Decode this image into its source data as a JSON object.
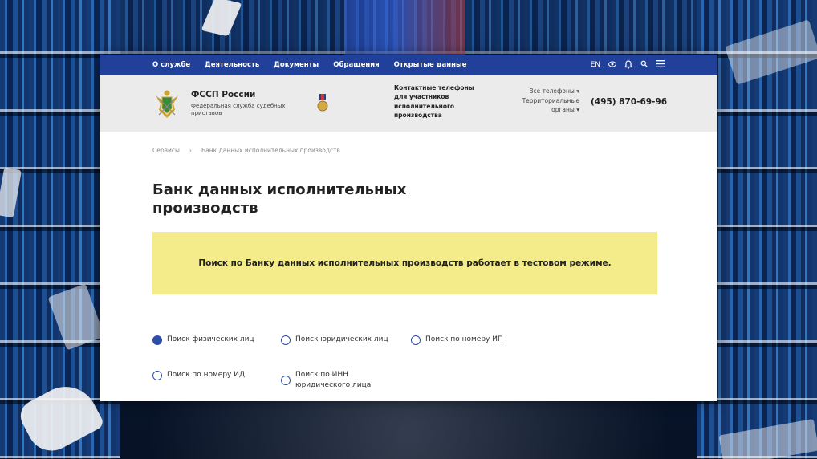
{
  "topnav": {
    "items": [
      "О службе",
      "Деятельность",
      "Документы",
      "Обращения",
      "Открытые данные"
    ],
    "lang": "EN"
  },
  "icons": {
    "vision": "eye-icon",
    "notifications": "bell-icon",
    "search": "search-icon",
    "menu": "menu-icon",
    "emblem": "fssp-emblem-icon",
    "medal": "medal-icon"
  },
  "org": {
    "name": "ФССП России",
    "subtitle": "Федеральная служба судебных приставов"
  },
  "contacts": {
    "label": "Контактные телефоны для участников исполнительного производства",
    "all_phones": "Все телефоны",
    "territorial": "Территориальные органы",
    "phone": "(495) 870-69-96"
  },
  "breadcrumbs": [
    "Сервисы",
    "Банк данных исполнительных производств"
  ],
  "page_title": "Банк данных исполнительных производств",
  "notice": "Поиск по Банку данных исполнительных производств работает в тестовом режиме.",
  "search_types": [
    {
      "label": "Поиск физических лиц",
      "selected": true
    },
    {
      "label": "Поиск юридических лиц",
      "selected": false
    },
    {
      "label": "Поиск по номеру ИП",
      "selected": false
    },
    {
      "label": "Поиск по номеру ИД",
      "selected": false
    },
    {
      "label": "Поиск по ИНН юридического лица",
      "selected": false
    }
  ],
  "colors": {
    "nav_bg": "#21409a",
    "notice_bg": "#f4ec8a",
    "radio": "#2f4ea8"
  }
}
